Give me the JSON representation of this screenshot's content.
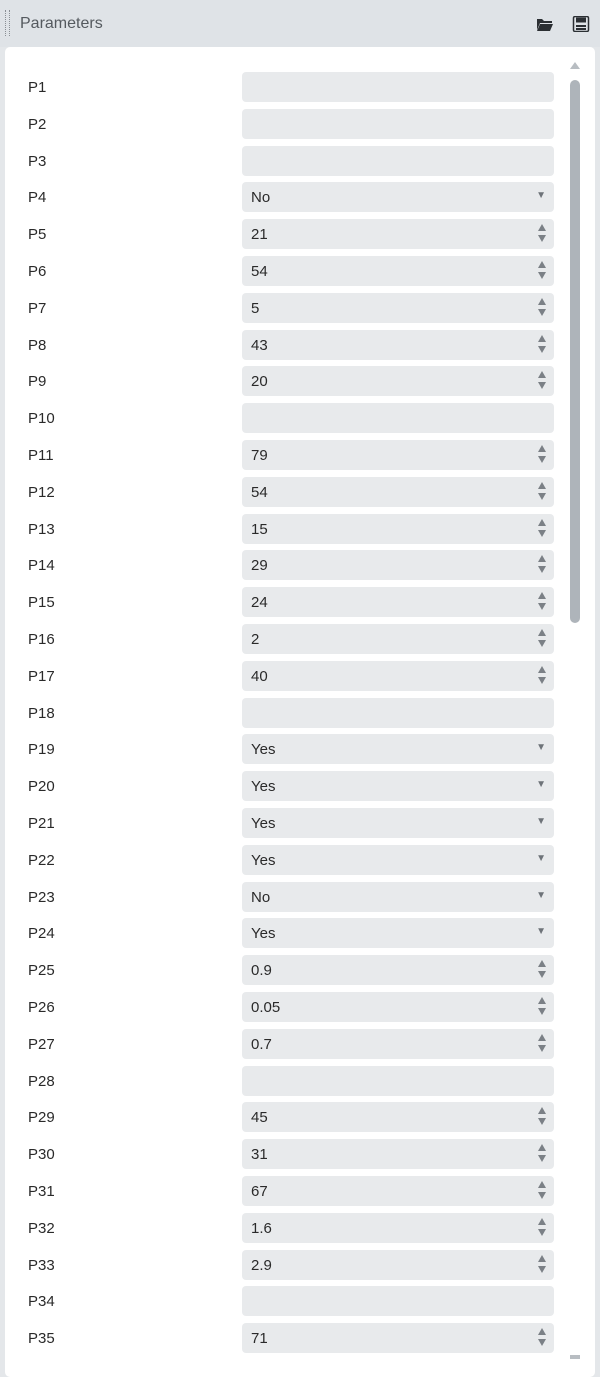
{
  "header": {
    "title": "Parameters",
    "icons": [
      "folder-open-icon",
      "save-icon"
    ]
  },
  "colors": {
    "header_bg": "#dfe3e7",
    "field_bg": "#e8eaec",
    "scrollbar": "#aeb4ba"
  },
  "params": [
    {
      "label": "P1",
      "type": "text",
      "value": ""
    },
    {
      "label": "P2",
      "type": "text",
      "value": ""
    },
    {
      "label": "P3",
      "type": "text",
      "value": ""
    },
    {
      "label": "P4",
      "type": "select",
      "value": "No"
    },
    {
      "label": "P5",
      "type": "number",
      "value": "21"
    },
    {
      "label": "P6",
      "type": "number",
      "value": "54"
    },
    {
      "label": "P7",
      "type": "number",
      "value": "5"
    },
    {
      "label": "P8",
      "type": "number",
      "value": "43"
    },
    {
      "label": "P9",
      "type": "number",
      "value": "20"
    },
    {
      "label": "P10",
      "type": "text",
      "value": ""
    },
    {
      "label": "P11",
      "type": "number",
      "value": "79"
    },
    {
      "label": "P12",
      "type": "number",
      "value": "54"
    },
    {
      "label": "P13",
      "type": "number",
      "value": "15"
    },
    {
      "label": "P14",
      "type": "number",
      "value": "29"
    },
    {
      "label": "P15",
      "type": "number",
      "value": "24"
    },
    {
      "label": "P16",
      "type": "number",
      "value": "2"
    },
    {
      "label": "P17",
      "type": "number",
      "value": "40"
    },
    {
      "label": "P18",
      "type": "text",
      "value": ""
    },
    {
      "label": "P19",
      "type": "select",
      "value": "Yes"
    },
    {
      "label": "P20",
      "type": "select",
      "value": "Yes"
    },
    {
      "label": "P21",
      "type": "select",
      "value": "Yes"
    },
    {
      "label": "P22",
      "type": "select",
      "value": "Yes"
    },
    {
      "label": "P23",
      "type": "select",
      "value": "No"
    },
    {
      "label": "P24",
      "type": "select",
      "value": "Yes"
    },
    {
      "label": "P25",
      "type": "number",
      "value": "0.9"
    },
    {
      "label": "P26",
      "type": "number",
      "value": "0.05"
    },
    {
      "label": "P27",
      "type": "number",
      "value": "0.7"
    },
    {
      "label": "P28",
      "type": "text",
      "value": ""
    },
    {
      "label": "P29",
      "type": "number",
      "value": "45"
    },
    {
      "label": "P30",
      "type": "number",
      "value": "31"
    },
    {
      "label": "P31",
      "type": "number",
      "value": "67"
    },
    {
      "label": "P32",
      "type": "number",
      "value": "1.6"
    },
    {
      "label": "P33",
      "type": "number",
      "value": "2.9"
    },
    {
      "label": "P34",
      "type": "text",
      "value": ""
    },
    {
      "label": "P35",
      "type": "number",
      "value": "71"
    }
  ]
}
